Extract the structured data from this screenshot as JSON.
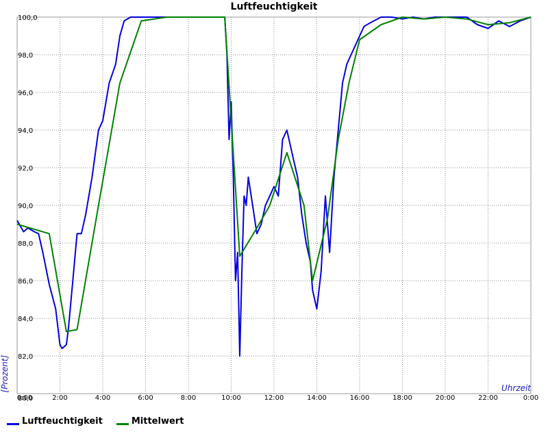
{
  "chart_data": {
    "type": "line",
    "title": "Luftfeuchtigkeit",
    "xlabel": "Uhrzeit",
    "ylabel": "[Prozent]",
    "xlim": [
      0,
      24
    ],
    "ylim": [
      80,
      100
    ],
    "grid": true,
    "legend_position": "bottom-left",
    "x_tick_labels": [
      "0:00",
      "2:00",
      "4:00",
      "6:00",
      "8:00",
      "10:00",
      "12:00",
      "14:00",
      "16:00",
      "18:00",
      "20:00",
      "22:00",
      "0:00"
    ],
    "y_tick_labels": [
      "80,0",
      "82,0",
      "84,0",
      "86,0",
      "88,0",
      "90,0",
      "92,0",
      "94,0",
      "96,0",
      "98,0",
      "100,0"
    ],
    "series": [
      {
        "name": "Luftfeuchtigkeit",
        "color": "#0000dd",
        "x": [
          0,
          0.3,
          0.5,
          0.8,
          1.0,
          1.2,
          1.5,
          1.8,
          2.0,
          2.1,
          2.3,
          2.4,
          2.6,
          2.8,
          3.0,
          3.2,
          3.5,
          3.8,
          4.0,
          4.3,
          4.6,
          4.8,
          5.0,
          5.3,
          5.5,
          6.0,
          7.0,
          8.0,
          9.0,
          9.7,
          9.8,
          9.9,
          10.0,
          10.1,
          10.2,
          10.3,
          10.4,
          10.5,
          10.6,
          10.7,
          10.8,
          11.0,
          11.2,
          11.4,
          11.6,
          11.8,
          12.0,
          12.2,
          12.4,
          12.6,
          12.7,
          12.9,
          13.1,
          13.3,
          13.5,
          13.7,
          13.8,
          13.9,
          14.0,
          14.2,
          14.4,
          14.6,
          14.8,
          15.0,
          15.2,
          15.4,
          15.6,
          15.8,
          16.0,
          16.2,
          16.5,
          17.0,
          17.5,
          18.0,
          18.5,
          19.0,
          19.5,
          20.0,
          20.5,
          21.0,
          21.5,
          22.0,
          22.5,
          23.0,
          23.5,
          24.0
        ],
        "values": [
          89.2,
          88.6,
          88.8,
          88.6,
          88.5,
          87.5,
          85.8,
          84.5,
          82.6,
          82.4,
          82.6,
          83.5,
          86.0,
          88.5,
          88.5,
          89.5,
          91.5,
          94.0,
          94.5,
          96.5,
          97.5,
          99.0,
          99.8,
          100.0,
          100.0,
          100.0,
          100.0,
          100.0,
          100.0,
          100.0,
          98.0,
          93.5,
          95.5,
          91.5,
          86.0,
          87.5,
          82.0,
          86.5,
          90.5,
          90.0,
          91.5,
          90.0,
          88.5,
          89.0,
          90.0,
          90.5,
          91.0,
          90.5,
          93.5,
          94.0,
          93.5,
          92.5,
          91.5,
          89.5,
          88.0,
          87.0,
          85.5,
          85.0,
          84.5,
          86.5,
          90.5,
          87.5,
          91.5,
          94.0,
          96.5,
          97.5,
          98.0,
          98.5,
          99.0,
          99.5,
          99.7,
          100.0,
          100.0,
          99.9,
          100.0,
          99.9,
          100.0,
          100.0,
          100.0,
          100.0,
          99.6,
          99.4,
          99.8,
          99.5,
          99.8,
          100.0
        ]
      },
      {
        "name": "Mittelwert",
        "color": "#008000",
        "x": [
          0,
          1.5,
          2.3,
          2.8,
          3.8,
          4.8,
          5.8,
          7.0,
          8.0,
          9.0,
          9.7,
          10.4,
          11.2,
          11.8,
          12.6,
          13.4,
          13.8,
          14.5,
          15.0,
          15.5,
          16.0,
          17.0,
          18.0,
          19.0,
          20.0,
          21.0,
          22.0,
          23.0,
          24.0
        ],
        "values": [
          89.0,
          88.5,
          83.3,
          83.4,
          90.0,
          96.5,
          99.8,
          100.0,
          100.0,
          100.0,
          100.0,
          87.3,
          88.8,
          90.0,
          92.8,
          90.0,
          86.0,
          89.3,
          93.5,
          96.5,
          98.8,
          99.6,
          100.0,
          99.9,
          100.0,
          99.9,
          99.6,
          99.7,
          100.0
        ]
      }
    ]
  }
}
